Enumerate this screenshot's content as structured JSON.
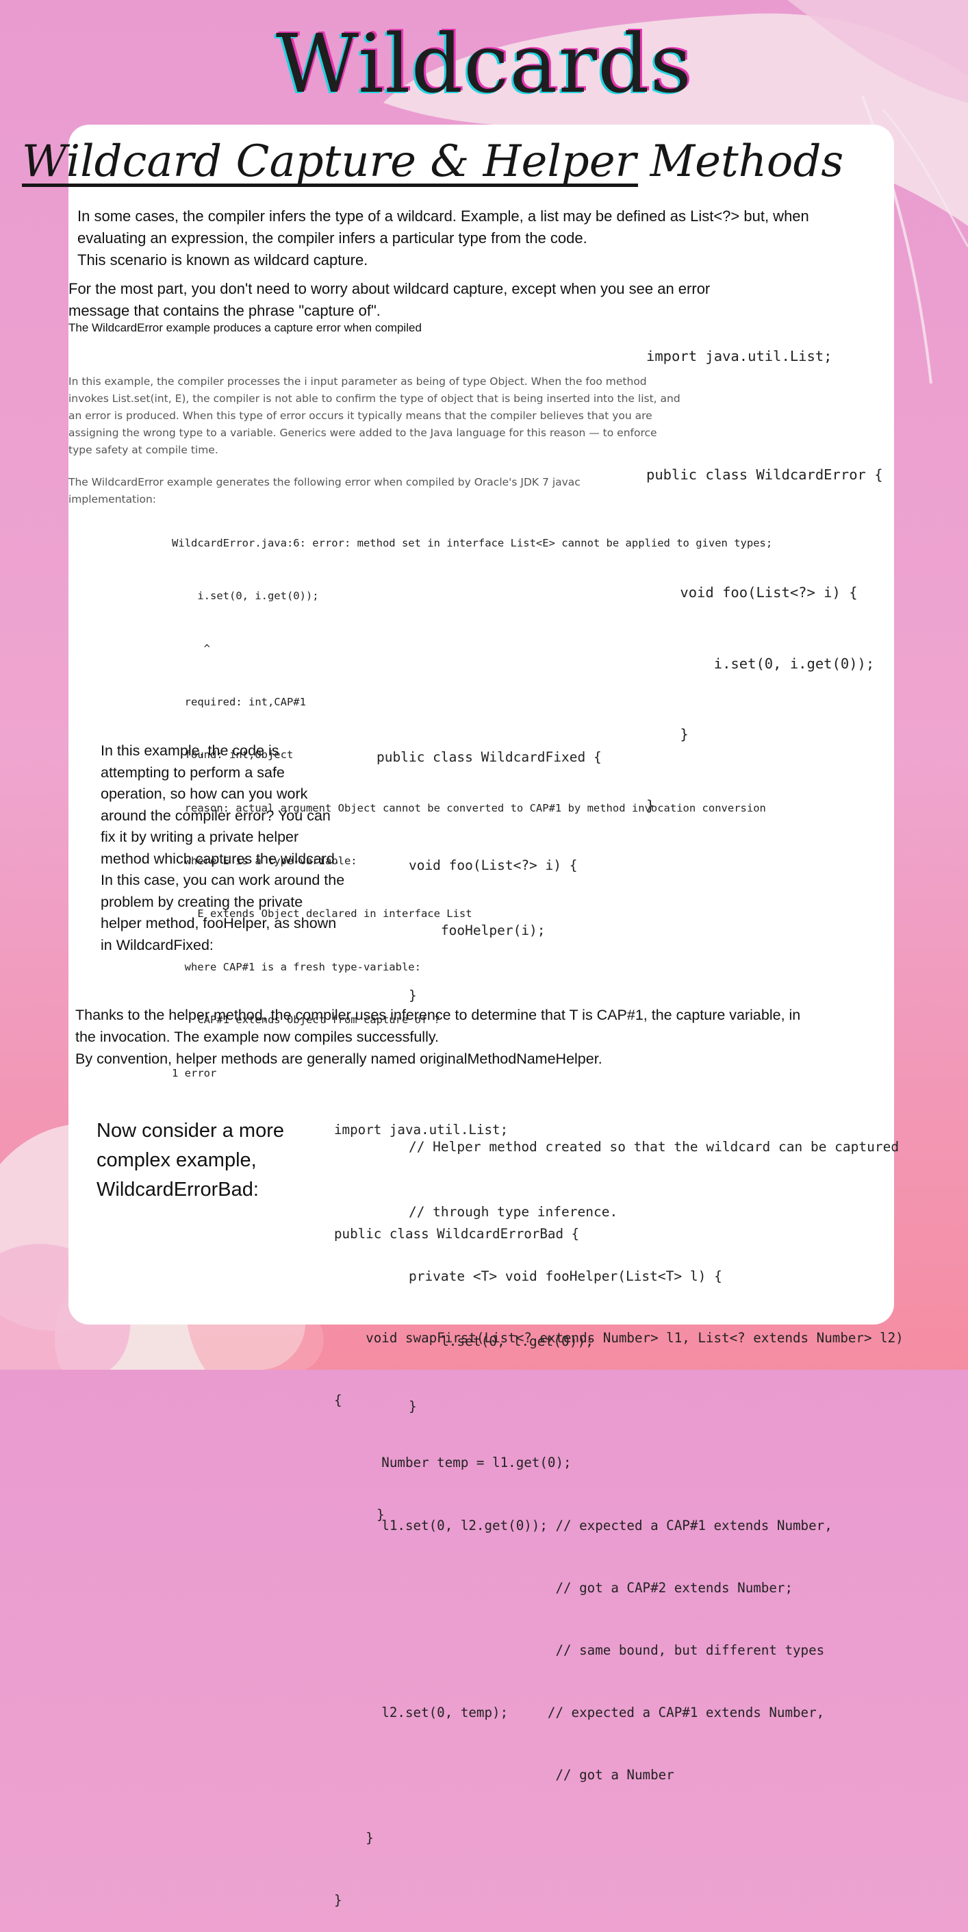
{
  "title": "Wildcards",
  "subtitle": "Wildcard Capture & Helper Methods",
  "intro": [
    "In some cases, the compiler infers the type of a wildcard. Example, a list may be defined as List<?> but, when",
    "evaluating an expression, the compiler infers a particular type from the code.",
    "This scenario is known as wildcard capture."
  ],
  "worry": [
    "For the most part, you don't need to worry about wildcard capture, except when you see an error",
    "message that contains the phrase \"capture of\"."
  ],
  "capture_error_note": "The WildcardError example produces a capture error when compiled",
  "explanation": [
    "In this example, the compiler processes the i input parameter as being of type Object. When the foo method",
    "invokes List.set(int, E), the compiler is not able to confirm the type of object that is being inserted into the list, and",
    "an error is produced. When this type of error occurs it typically means that the compiler believes that you are",
    "assigning the wrong type to a variable. Generics were added to the Java language for this reason — to enforce",
    "type safety at compile time."
  ],
  "jdk_note": [
    "The WildcardError example generates the following error when compiled by Oracle's JDK 7 javac",
    "implementation:"
  ],
  "code_wildcard_error": [
    "import java.util.List;",
    "",
    "public class WildcardError {",
    "",
    "    void foo(List<?> i) {",
    "        i.set(0, i.get(0));",
    "    }",
    "}"
  ],
  "compiler_output": [
    "WildcardError.java:6: error: method set in interface List<E> cannot be applied to given types;",
    "    i.set(0, i.get(0));",
    "     ^",
    "  required: int,CAP#1",
    "  found: int,Object",
    "  reason: actual argument Object cannot be converted to CAP#1 by method invocation conversion",
    "  where E is a type-variable:",
    "    E extends Object declared in interface List",
    "  where CAP#1 is a fresh type-variable:",
    "    CAP#1 extends Object from capture of ?",
    "1 error"
  ],
  "code_wildcard_fixed": [
    "public class WildcardFixed {",
    "",
    "    void foo(List<?> i) {",
    "        fooHelper(i);",
    "    }",
    "",
    "",
    "    // Helper method created so that the wildcard can be captured",
    "    // through type inference.",
    "    private <T> void fooHelper(List<T> l) {",
    "        l.set(0, l.get(0));",
    "    }",
    "",
    "}"
  ],
  "fix_explanation": [
    "In this example, the code is",
    "attempting to perform a safe",
    "operation, so how can you work",
    "around the compiler error? You can",
    "fix it by writing a private helper",
    "method which captures the wildcard.",
    "In this case, you can work around the",
    "problem by creating the private",
    "helper method, fooHelper, as shown",
    "in WildcardFixed:"
  ],
  "thanks": [
    "Thanks to the helper method, the compiler uses inference to determine that T is CAP#1, the capture variable, in",
    "the invocation. The example now compiles successfully.",
    "By convention, helper methods are generally named originalMethodNameHelper."
  ],
  "complex_intro": [
    "Now consider a more",
    "complex example,",
    "WildcardErrorBad:"
  ],
  "code_wildcard_error_bad": [
    "import java.util.List;",
    "",
    "public class WildcardErrorBad {",
    "",
    "    void swapFirst(List<? extends Number> l1, List<? extends Number> l2)",
    "{",
    "      Number temp = l1.get(0);",
    "      l1.set(0, l2.get(0)); // expected a CAP#1 extends Number,",
    "                            // got a CAP#2 extends Number;",
    "                            // same bound, but different types",
    "      l2.set(0, temp);     // expected a CAP#1 extends Number,",
    "                            // got a Number",
    "    }",
    "}"
  ],
  "colors": {
    "background_top": "#e99bd0",
    "background_bottom": "#f58da2",
    "card": "#ffffff",
    "title_cyan": "#22d3e0",
    "title_magenta": "#e636b3"
  }
}
